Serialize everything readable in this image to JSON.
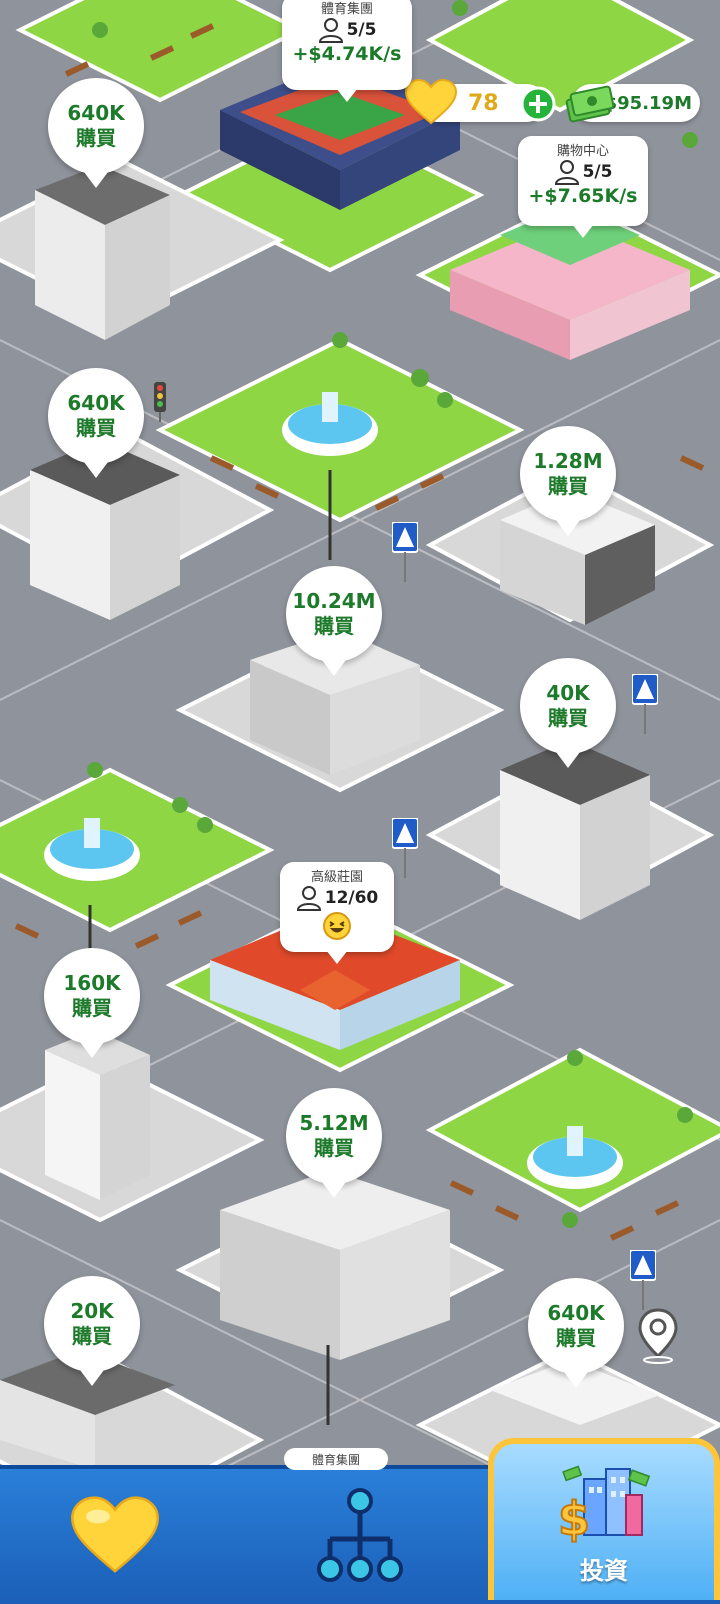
{
  "hud": {
    "hearts": "78",
    "money": "$95.19M",
    "colors": {
      "heart": "#ffd43a",
      "hearts_text": "#e0a91a",
      "add": "#25b33a",
      "money_text": "#1d7a2a"
    }
  },
  "groups": [
    {
      "name": "體育集團",
      "occupancy": "5/5",
      "income": "+$4.74K/s"
    },
    {
      "name": "購物中心",
      "occupancy": "5/5",
      "income": "+$7.65K/s"
    },
    {
      "name": "高級莊園",
      "occupancy": "12/60",
      "mood": "laughing-face-icon"
    }
  ],
  "lots": [
    {
      "price": "640K",
      "action": "購買"
    },
    {
      "price": "640K",
      "action": "購買"
    },
    {
      "price": "1.28M",
      "action": "購買"
    },
    {
      "price": "10.24M",
      "action": "購買"
    },
    {
      "price": "40K",
      "action": "購買"
    },
    {
      "price": "160K",
      "action": "購買"
    },
    {
      "price": "5.12M",
      "action": "購買"
    },
    {
      "price": "20K",
      "action": "購買"
    },
    {
      "price": "640K",
      "action": "購買"
    }
  ],
  "bottom_tag": "體育集團",
  "tabs": [
    {
      "icon": "heart-icon"
    },
    {
      "icon": "org-chart-icon"
    },
    {
      "label": "投資",
      "icon": "city-money-icon",
      "active": true
    }
  ],
  "map_icons": [
    "crosswalk-sign-icon",
    "location-pin-icon",
    "traffic-light-icon"
  ],
  "colors": {
    "grass": "#8fd645",
    "road": "#8f939b",
    "lot": "#d8d8d8",
    "tab_bar": "#2a7fd8",
    "active_tab_border": "#ffc53a"
  }
}
